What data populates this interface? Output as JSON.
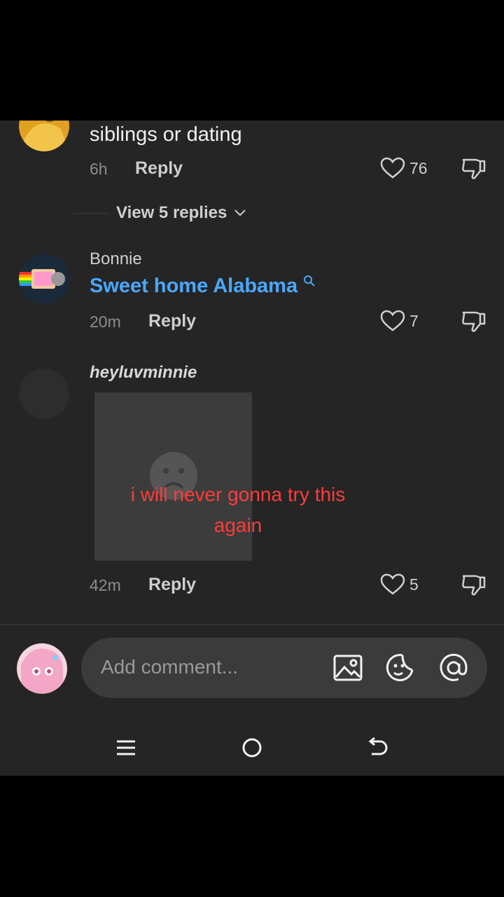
{
  "comments": [
    {
      "text": "siblings or dating",
      "time": "6h",
      "reply_label": "Reply",
      "likes": "76",
      "view_replies": "View 5 replies"
    },
    {
      "username": "Bonnie",
      "link_text": "Sweet home Alabama",
      "time": "20m",
      "reply_label": "Reply",
      "likes": "7"
    },
    {
      "username": "heyluvminnie",
      "time": "42m",
      "reply_label": "Reply",
      "likes": "5"
    }
  ],
  "overlay_caption": "i will never gonna try this again",
  "composer": {
    "placeholder": "Add comment..."
  },
  "colors": {
    "link": "#4aa8ff",
    "caption": "#ff3b3b",
    "background": "#252525"
  }
}
